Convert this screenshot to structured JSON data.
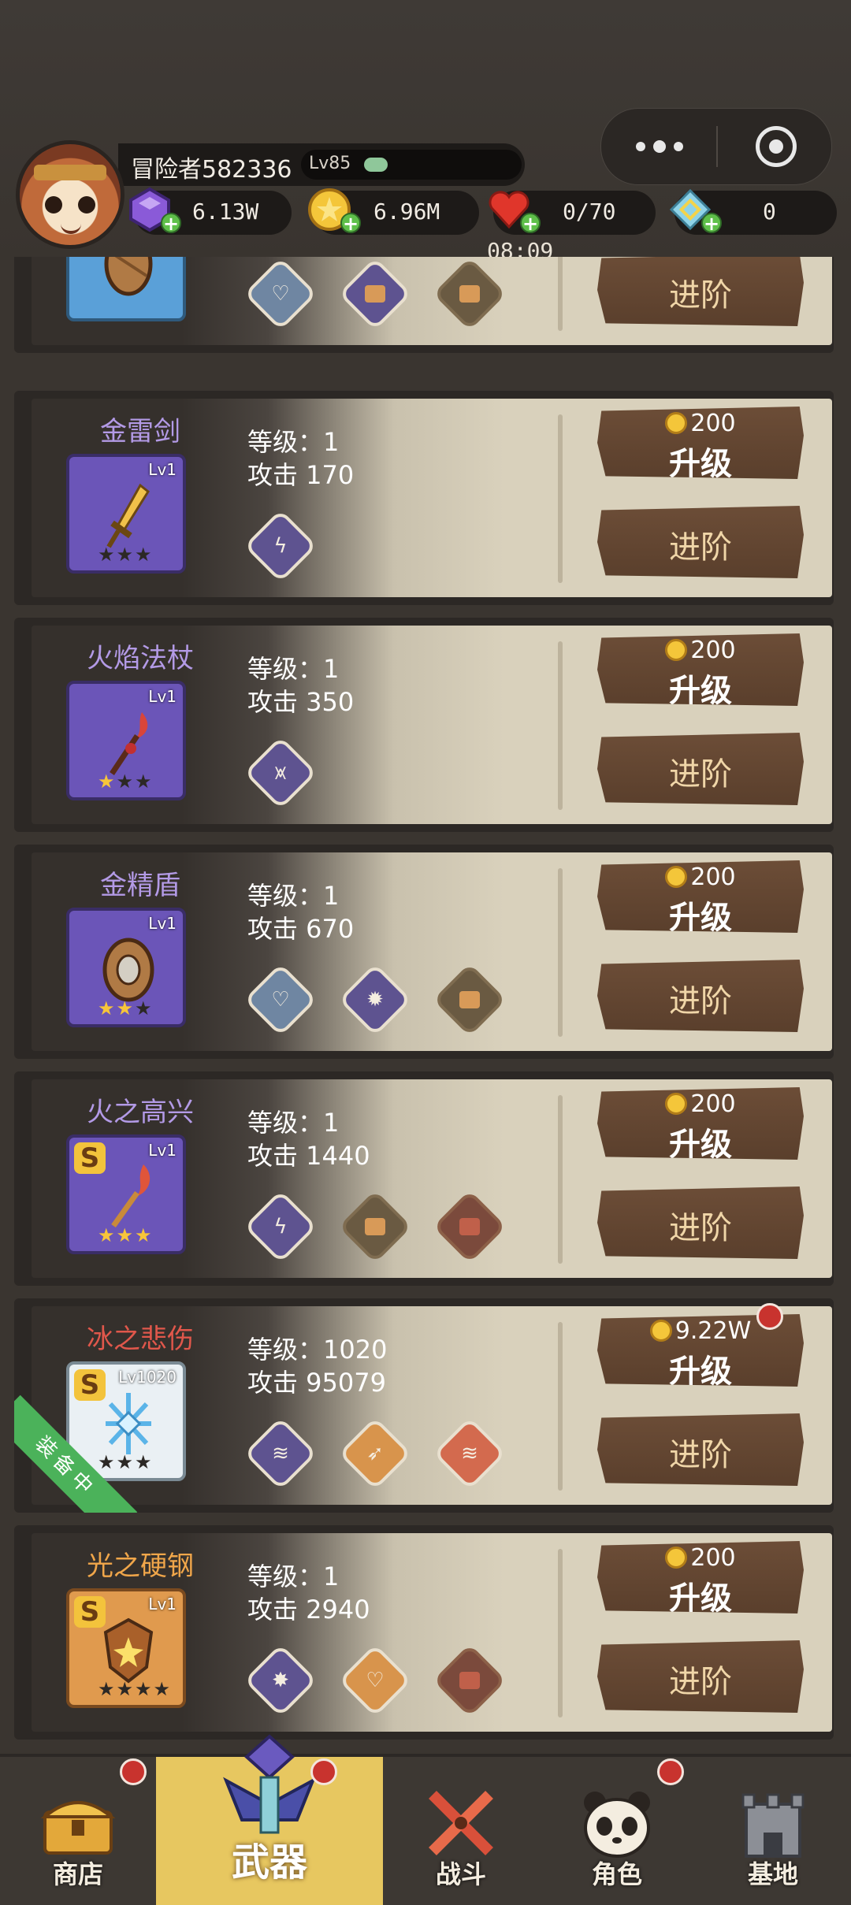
{
  "player": {
    "name": "冒险者582336",
    "level": "Lv85"
  },
  "resources": {
    "gems": "6.13W",
    "gold": "6.96M",
    "stamina": "0/70",
    "stamina_timer": "08:09",
    "tickets": "0"
  },
  "colors": {
    "accent_gold": "#e7c760",
    "panel_dark": "#35302c",
    "panel_light": "#d9d1bc",
    "sign_wood": "#6c4d37",
    "purple_name": "#b39ae6",
    "red_name": "#e0574b",
    "gold_name": "#f0a64a",
    "badge_red_dot": "#c8332e"
  },
  "labels": {
    "upgrade": "升级",
    "advance": "进阶",
    "equipped": "装备中"
  },
  "weapons": [
    {
      "name": "",
      "level_text": "",
      "attack_text": "",
      "icon_level": "",
      "cost": "",
      "stars_on": 0,
      "icon": "shield-icon"
    },
    {
      "name": "金雷剑",
      "level_text": "等级：1",
      "attack_text": "攻击 170",
      "icon_level": "Lv1",
      "cost": "200",
      "stars_on": 0,
      "icon": "lightning-sword-icon"
    },
    {
      "name": "火焰法杖",
      "level_text": "等级：1",
      "attack_text": "攻击 350",
      "icon_level": "Lv1",
      "cost": "200",
      "stars_on": 1,
      "icon": "fire-staff-icon"
    },
    {
      "name": "金精盾",
      "level_text": "等级：1",
      "attack_text": "攻击 670",
      "icon_level": "Lv1",
      "cost": "200",
      "stars_on": 2,
      "icon": "shield-icon"
    },
    {
      "name": "火之高兴",
      "level_text": "等级：1",
      "attack_text": "攻击 1440",
      "icon_level": "Lv1",
      "cost": "200",
      "stars_on": 3,
      "icon": "fire-sword-icon"
    },
    {
      "name": "冰之悲伤",
      "level_text": "等级：1020",
      "attack_text": "攻击 95079",
      "icon_level": "Lv1020",
      "cost": "9.22W",
      "stars_on": 0,
      "icon": "ice-crystal-icon"
    },
    {
      "name": "光之硬钢",
      "level_text": "等级：1",
      "attack_text": "攻击 2940",
      "icon_level": "Lv1",
      "cost": "200",
      "stars_on": 0,
      "icon": "light-shield-icon"
    }
  ],
  "nav": [
    {
      "label": "商店",
      "icon": "treasure-chest-icon"
    },
    {
      "label": "武器",
      "icon": "weapon-icon"
    },
    {
      "label": "战斗",
      "icon": "crossed-swords-icon"
    },
    {
      "label": "角色",
      "icon": "panda-icon"
    },
    {
      "label": "基地",
      "icon": "castle-icon"
    }
  ]
}
